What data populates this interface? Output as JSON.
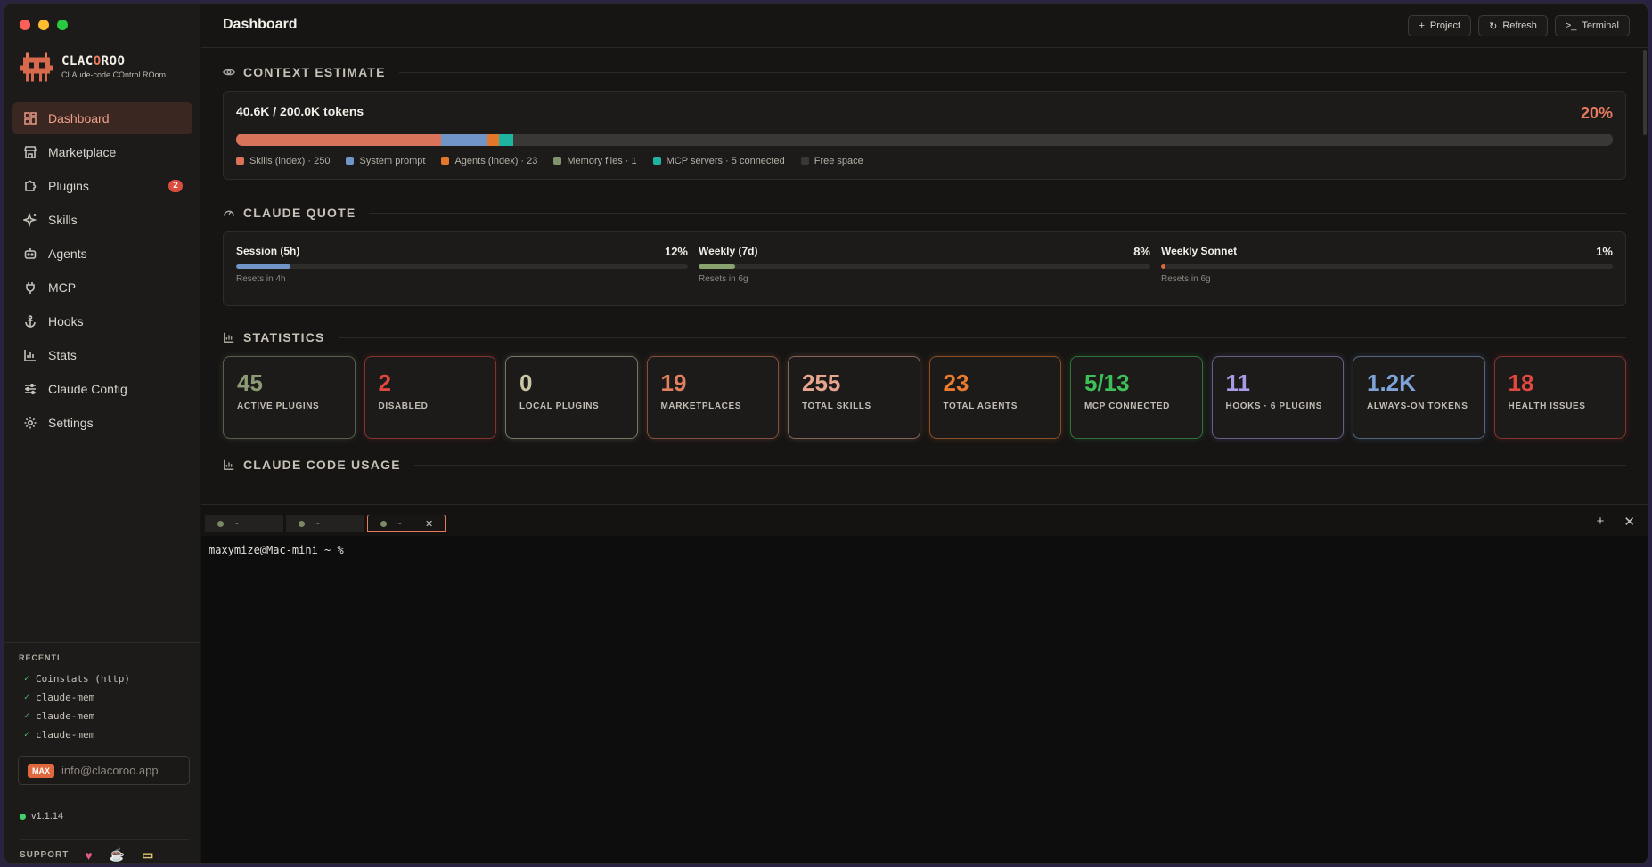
{
  "app": {
    "name_part1": "CLAC",
    "name_part2": "O",
    "name_part3": "ROO",
    "subtitle": "CLAude-code COntrol ROom"
  },
  "sidebar": {
    "items": [
      {
        "label": "Dashboard",
        "icon": "dashboard-icon",
        "active": true
      },
      {
        "label": "Marketplace",
        "icon": "store-icon"
      },
      {
        "label": "Plugins",
        "icon": "puzzle-icon",
        "badge": "2"
      },
      {
        "label": "Skills",
        "icon": "sparkle-icon"
      },
      {
        "label": "Agents",
        "icon": "robot-icon"
      },
      {
        "label": "MCP",
        "icon": "plug-icon"
      },
      {
        "label": "Hooks",
        "icon": "anchor-icon"
      },
      {
        "label": "Stats",
        "icon": "bar-chart-icon"
      },
      {
        "label": "Claude Config",
        "icon": "sliders-icon"
      },
      {
        "label": "Settings",
        "icon": "gear-icon"
      }
    ],
    "recent_title": "RECENTI",
    "recent": [
      "Coinstats (http)",
      "claude-mem",
      "claude-mem",
      "claude-mem"
    ],
    "account_badge": "MAX",
    "account_email": "info@clacoroo.app",
    "version": "v1.1.14",
    "support_label": "SUPPORT"
  },
  "header": {
    "title": "Dashboard",
    "actions": {
      "project": "Project",
      "refresh": "Refresh",
      "terminal": "Terminal"
    }
  },
  "context": {
    "section_title": "CONTEXT ESTIMATE",
    "tokens": "40.6K / 200.0K tokens",
    "percent": "20%",
    "segments": [
      {
        "label": "Skills (index) · 250",
        "color": "#d9735a",
        "fraction": 0.149
      },
      {
        "label": "System prompt",
        "color": "#6f96c6",
        "fraction": 0.033
      },
      {
        "label": "Agents (index) · 23",
        "color": "#e3782b",
        "fraction": 0.009
      },
      {
        "label": "Memory files · 1",
        "color": "#7f946b",
        "fraction": 0.0
      },
      {
        "label": "MCP servers · 5 connected",
        "color": "#1fb3a1",
        "fraction": 0.01
      },
      {
        "label": "Free space",
        "color": "#3a3836",
        "fraction": 0.799
      }
    ]
  },
  "quota": {
    "section_title": "CLAUDE QUOTE",
    "items": [
      {
        "label": "Session (5h)",
        "percent": "12%",
        "fraction": 0.12,
        "reset": "Resets in 4h",
        "color": "#6f96c6"
      },
      {
        "label": "Weekly (7d)",
        "percent": "8%",
        "fraction": 0.08,
        "reset": "Resets in 6g",
        "color": "#8aa36e"
      },
      {
        "label": "Weekly Sonnet",
        "percent": "1%",
        "fraction": 0.01,
        "reset": "Resets in 6g",
        "color": "#e0683f"
      }
    ]
  },
  "statistics": {
    "section_title": "STATISTICS",
    "cards": [
      {
        "value": "45",
        "label": "ACTIVE PLUGINS",
        "color": "#8d9a76"
      },
      {
        "value": "2",
        "label": "DISABLED",
        "color": "#e0483f"
      },
      {
        "value": "0",
        "label": "LOCAL PLUGINS",
        "color": "#c9c7a6"
      },
      {
        "value": "19",
        "label": "MARKETPLACES",
        "color": "#e0805e"
      },
      {
        "value": "255",
        "label": "TOTAL SKILLS",
        "color": "#e7a58f"
      },
      {
        "value": "23",
        "label": "TOTAL AGENTS",
        "color": "#ea7b2e"
      },
      {
        "value": "5/13",
        "label": "MCP CONNECTED",
        "color": "#3ebf57"
      },
      {
        "value": "11",
        "label": "HOOKS · 6 PLUGINS",
        "color": "#a99ae6"
      },
      {
        "value": "1.2K",
        "label": "ALWAYS-ON TOKENS",
        "color": "#7ea3d8"
      },
      {
        "value": "18",
        "label": "HEALTH ISSUES",
        "color": "#e0483f"
      }
    ]
  },
  "usage": {
    "section_title": "CLAUDE CODE USAGE"
  },
  "terminal": {
    "tabs": [
      {
        "label": "~"
      },
      {
        "label": "~"
      },
      {
        "label": "~",
        "active": true
      }
    ],
    "prompt": "maxymize@Mac-mini ~ %"
  }
}
